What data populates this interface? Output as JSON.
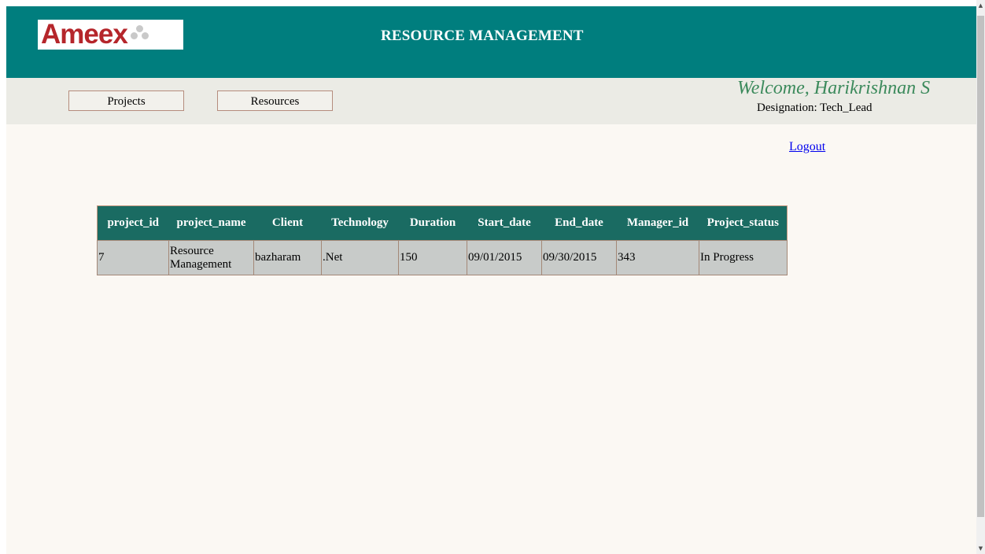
{
  "header": {
    "logo_text": "Ameex",
    "title": "RESOURCE MANAGEMENT"
  },
  "nav": {
    "projects_label": "Projects",
    "resources_label": "Resources"
  },
  "user": {
    "welcome": "Welcome, Harikrishnan S",
    "designation": "Designation: Tech_Lead"
  },
  "logout_label": "Logout",
  "table": {
    "columns": [
      "project_id",
      "project_name",
      "Client",
      "Technology",
      "Duration",
      "Start_date",
      "End_date",
      "Manager_id",
      "Project_status"
    ],
    "rows": [
      [
        "7",
        "Resource Management",
        "bazharam",
        ".Net",
        "150",
        "09/01/2015",
        "09/30/2015",
        "343",
        "In Progress"
      ]
    ]
  },
  "colors": {
    "header_bg": "#007e7e",
    "table_header_bg": "#1a6b62",
    "logo_red": "#b5262b",
    "welcome_green": "#3c8a5c"
  },
  "icons": [
    "logo-dots-icon",
    "scroll-up-arrow-icon",
    "scroll-down-arrow-icon"
  ]
}
